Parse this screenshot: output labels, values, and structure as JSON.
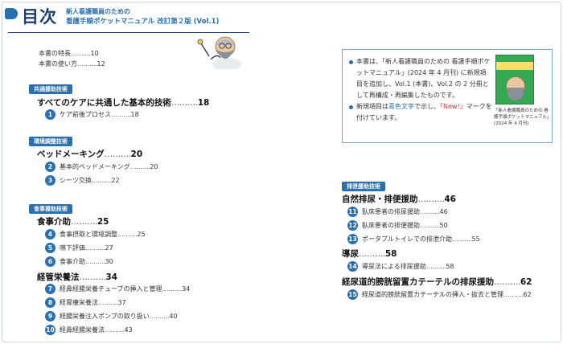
{
  "header": {
    "title": "目次",
    "subtitle_line1": "新人看護職員のための",
    "subtitle_line2": "看護手順ポケットマニュアル 改訂第２版 (Vol.1)"
  },
  "intro": [
    {
      "label": "本書の特長",
      "page": "10"
    },
    {
      "label": "本書の使い方",
      "page": "12"
    }
  ],
  "sections": {
    "common": {
      "category": "共通援助技術",
      "heading": {
        "label": "すべてのケアに共通した基本的技術",
        "page": "18"
      },
      "items": [
        {
          "num": "1",
          "label": "ケア前後プロセス",
          "page": "18"
        }
      ]
    },
    "environment": {
      "category": "環境調整技術",
      "heading": {
        "label": "ベッドメーキング",
        "page": "20"
      },
      "items": [
        {
          "num": "2",
          "label": "基本的ベッドメーキング",
          "page": "20"
        },
        {
          "num": "3",
          "label": "シーツ交換",
          "page": "22"
        }
      ]
    },
    "meal": {
      "category": "食事援助技術",
      "heading1": {
        "label": "食事介助",
        "page": "25"
      },
      "items1": [
        {
          "num": "4",
          "label": "食事摂取と環境調整",
          "page": "25"
        },
        {
          "num": "5",
          "label": "嚥下評価",
          "page": "27"
        },
        {
          "num": "6",
          "label": "食事介助",
          "page": "30"
        }
      ],
      "heading2": {
        "label": "経管栄養法",
        "page": "34"
      },
      "items2": [
        {
          "num": "7",
          "label": "経鼻経腸栄養チューブの挿入と管理",
          "page": "34"
        },
        {
          "num": "8",
          "label": "経胃瘻栄養法",
          "page": "37"
        },
        {
          "num": "9",
          "label": "経腸栄養注入ポンプの取り扱い",
          "page": "40"
        },
        {
          "num": "10",
          "label": "経鼻経腸栄養法",
          "page": "43"
        }
      ]
    },
    "excretion": {
      "category": "排泄援助技術",
      "heading1": {
        "label": "自然排尿・排便援助",
        "page": "46"
      },
      "items1": [
        {
          "num": "11",
          "label": "臥床患者の排尿援助",
          "page": "46"
        },
        {
          "num": "12",
          "label": "臥床患者の排便援助",
          "page": "50"
        },
        {
          "num": "13",
          "label": "ポータブルトイレでの排泄介助",
          "page": "55"
        }
      ],
      "heading2": {
        "label": "導尿",
        "page": "58"
      },
      "items2": [
        {
          "num": "14",
          "label": "導尿法による排尿援助",
          "page": "58"
        }
      ],
      "heading3": {
        "label": "経尿道的膀胱留置カテーテルの排尿援助",
        "page": "62"
      },
      "items3": [
        {
          "num": "15",
          "label": "経尿道的膀胱留置カテーテルの挿入・抜去と管理",
          "page": "62"
        }
      ]
    }
  },
  "info": {
    "p1_a": "本書は、「新人看護職員のための 看護手順ポケットマニュアル」(2024 年 4 月刊) に新規項目を追加し、Vol.1 (本書)、Vol.2 の 2 分冊として再構成・再編集したものです。",
    "p2_a": "新規項目は",
    "p2_blue": "青色文字",
    "p2_b": "で示し、",
    "p2_red": "「New!」",
    "p2_c": "マークを付けています。",
    "caption": "「新人看護職員のための 看護手順ポケットマニュアル」(2024 年 4 月刊)"
  },
  "dots": "……….",
  "colors": {
    "accent": "#2a6fb0",
    "title": "#1c3f6e",
    "new_mark": "#dd3333"
  }
}
